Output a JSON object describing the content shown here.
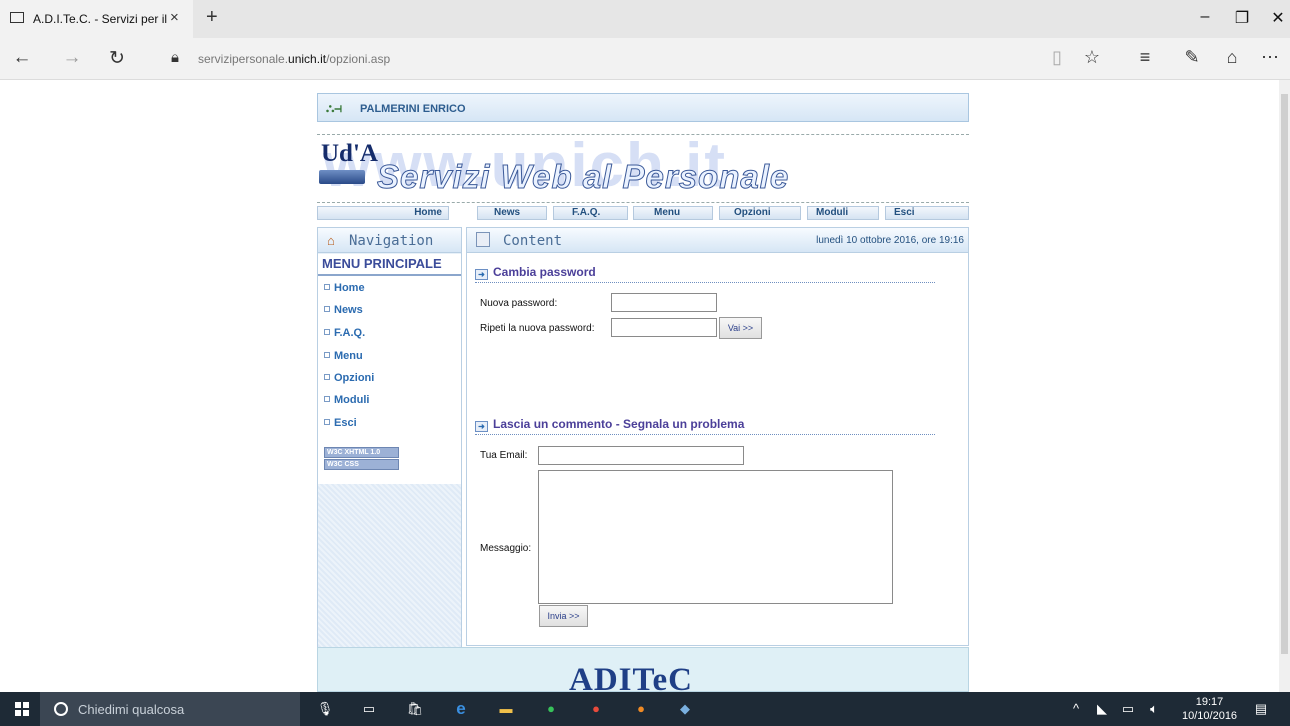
{
  "browser": {
    "tab_title": "A.D.I.Te.C. - Servizi per il",
    "tab_close": "×",
    "new_tab": "+",
    "url_pre": "servizipersonale.",
    "url_host": "unich.it",
    "url_path": "/opzioni.asp",
    "win_min": "–",
    "win_max": "❐",
    "win_close": "✕"
  },
  "site": {
    "user_name": "PALMERINI ENRICO",
    "watermark": "www.unich.it",
    "logo_text": "Ud'A",
    "banner_title": "Servizi Web al Personale",
    "top_menu": [
      "Home",
      "News",
      "F.A.Q.",
      "Menu",
      "Opzioni",
      "Moduli",
      "Esci"
    ],
    "nav_heading": "Navigation",
    "menu_title": "MENU PRINCIPALE",
    "menu_items": [
      "Home",
      "News",
      "F.A.Q.",
      "Menu",
      "Opzioni",
      "Moduli",
      "Esci"
    ],
    "badge_xhtml": "W3C XHTML 1.0",
    "badge_css": "W3C CSS",
    "content_heading": "Content",
    "date_text": "lunedì 10 ottobre 2016, ore 19:16",
    "footer_brand": "ADITeC"
  },
  "password_form": {
    "title": "Cambia password",
    "new_label": "Nuova password:",
    "repeat_label": "Ripeti la nuova password:",
    "new_value": "",
    "repeat_value": "",
    "submit": "Vai >>"
  },
  "comment_form": {
    "title": "Lascia un commento - Segnala un problema",
    "email_label": "Tua Email:",
    "email_value": "",
    "message_label": "Messaggio:",
    "message_value": "",
    "submit": "Invia >>"
  },
  "taskbar": {
    "search_placeholder": "Chiedimi qualcosa",
    "time": "19:17",
    "date": "10/10/2016"
  },
  "colors": {
    "accent": "#2b6bb0",
    "taskbar": "#1e2a36"
  }
}
